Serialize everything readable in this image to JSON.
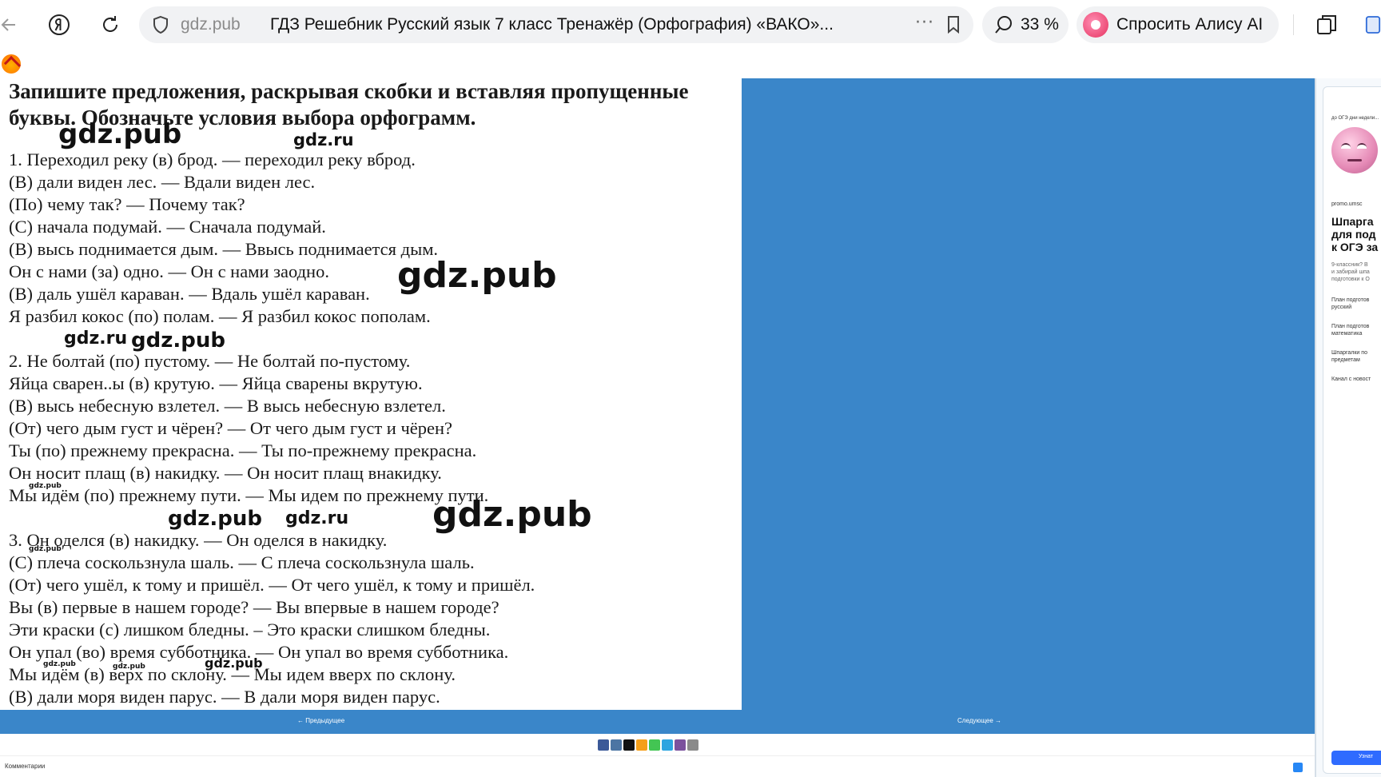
{
  "browser": {
    "domain": "gdz.pub",
    "tab_title": "ГДЗ Решебник Русский язык 7 класс Тренажёр (Орфография) «ВАКО»...",
    "more_label": "···",
    "zoom": "33 %",
    "alice_label": "Спросить Алису AI"
  },
  "exercise": {
    "heading": "Запишите предложения, раскрывая скобки и вставляя пропущенные буквы. Обозначьте условия выбора орфограмм.",
    "lines": [
      "1. Переходил реку (в) брод. — переходил реку вброд.",
      "(В) дали виден лес. — Вдали виден лес.",
      "(По) чему так? — Почему так?",
      "(С) начала подумай. — Сначала подумай.",
      "(В) высь поднимается дым. — Ввысь поднимается дым.",
      "Он с нами (за) одно. — Он с нами заодно.",
      "(В) даль ушёл караван. — Вдаль ушёл караван.",
      "Я разбил кокос (по) полам. — Я разбил кокос пополам.",
      "2. Не болтай (по) пустому. — Не болтай по-пустому.",
      "Яйца сварен..ы (в) крутую. — Яйца сварены вкрутую.",
      "(В) высь небесную взлетел. — В высь небесную взлетел.",
      "(От) чего дым густ и чёрен? — От чего дым густ и чёрен?",
      "Ты (по) прежнему прекрасна. — Ты по-прежнему прекрасна.",
      "Он носит плащ (в) накидку. — Он носит плащ внакидку.",
      "Мы идём (по) прежнему пути. — Мы идем по прежнему пути.",
      "3. Он оделся (в) накидку. — Он оделся в накидку.",
      "(С) плеча соскользнула шаль. — С плеча соскользнула шаль.",
      "(От) чего ушёл, к тому и пришёл. — От чего ушёл, к тому и пришёл.",
      "Вы (в) первые в нашем городе? — Вы впервые в нашем городе?",
      "Эти краски (с) лишком бледны. – Это краски слишком бледны.",
      "Он упал (во) время субботника. — Он упал во время субботника.",
      "Мы идём (в) верх по склону. — Мы идем вверх по склону.",
      "(В) дали моря виден парус. — В дали моря виден парус."
    ],
    "watermarks": [
      "gdz.pub",
      "gdz.ru"
    ]
  },
  "navigation": {
    "prev": "← Предыдущее",
    "next": "Следующее →"
  },
  "footer": {
    "comments_label": "Комментарии"
  },
  "ad": {
    "top_text": "до ОГЭ дни недели...",
    "source": "promo.umsc",
    "title_lines": [
      "Шпарга",
      "для под",
      "к ОГЭ за"
    ],
    "desc_lines": [
      "9-классник? В",
      "и забирай шпа",
      "подготовки к О"
    ],
    "items": [
      [
        "План подготов",
        "русский"
      ],
      [
        "План подготов",
        "математика"
      ],
      [
        "Шпаргалки по",
        "предметам"
      ],
      [
        "Канал с новост"
      ]
    ],
    "button": "Узнат"
  },
  "colors": {
    "page_blue": "#3a86c9",
    "chrome_pill": "#f1f2f4",
    "alice_accent": "#e6325f"
  }
}
